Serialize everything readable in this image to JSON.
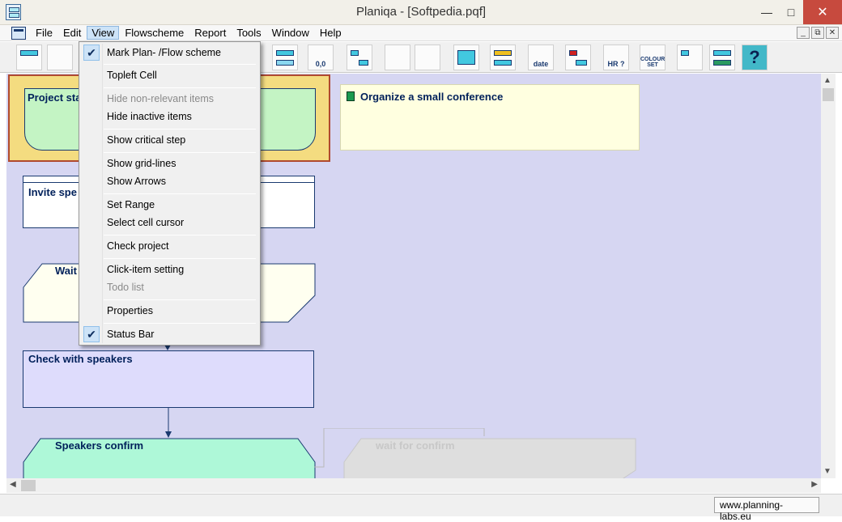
{
  "window": {
    "title": "Planiqa - [Softpedia.pqf]"
  },
  "menubar": {
    "items": [
      "File",
      "Edit",
      "View",
      "Flowscheme",
      "Report",
      "Tools",
      "Window",
      "Help"
    ]
  },
  "toolbar": {
    "date_label": "date",
    "coords_label": "0,0",
    "hr_label": "HR ?",
    "colour_label": "COLOUR SET",
    "help_label": "?"
  },
  "view_menu": {
    "items": [
      {
        "label": "Mark Plan- /Flow scheme",
        "checked": true,
        "enabled": true
      },
      {
        "label": "Topleft Cell",
        "checked": false,
        "enabled": true
      },
      {
        "label": "Hide non-relevant items",
        "checked": false,
        "enabled": false
      },
      {
        "label": "Hide inactive items",
        "checked": false,
        "enabled": true
      },
      {
        "label": "Show critical step",
        "checked": false,
        "enabled": true
      },
      {
        "label": "Show grid-lines",
        "checked": false,
        "enabled": true
      },
      {
        "label": "Show Arrows",
        "checked": false,
        "enabled": true
      },
      {
        "label": "Set Range",
        "checked": false,
        "enabled": true
      },
      {
        "label": "Select cell cursor",
        "checked": false,
        "enabled": true
      },
      {
        "label": "Check project",
        "checked": false,
        "enabled": true
      },
      {
        "label": "Click-item setting",
        "checked": false,
        "enabled": true
      },
      {
        "label": "Todo list",
        "checked": false,
        "enabled": false
      },
      {
        "label": "Properties",
        "checked": false,
        "enabled": true
      },
      {
        "label": "Status Bar",
        "checked": true,
        "enabled": true
      }
    ]
  },
  "flowscheme": {
    "nodes": [
      {
        "label": "Project sta",
        "color": "#c4f4c4"
      },
      {
        "label": "Invite spe",
        "color": "#ffffff"
      },
      {
        "label": "Wait",
        "color": "#fffff0"
      },
      {
        "label": "Check with speakers",
        "color": "#dedcfc"
      },
      {
        "label": "Speakers confirm",
        "color": "#aef8d8"
      },
      {
        "label": "wait for confirm",
        "color": "#dedede"
      }
    ],
    "project_title": "Organize a small conference"
  },
  "statusbar": {
    "url": "www.planning-labs.eu"
  },
  "colors": {
    "canvas": "#d6d6f2",
    "selection_border": "#b04a30",
    "selection_fill": "#f4dc80",
    "text": "#00205a"
  }
}
